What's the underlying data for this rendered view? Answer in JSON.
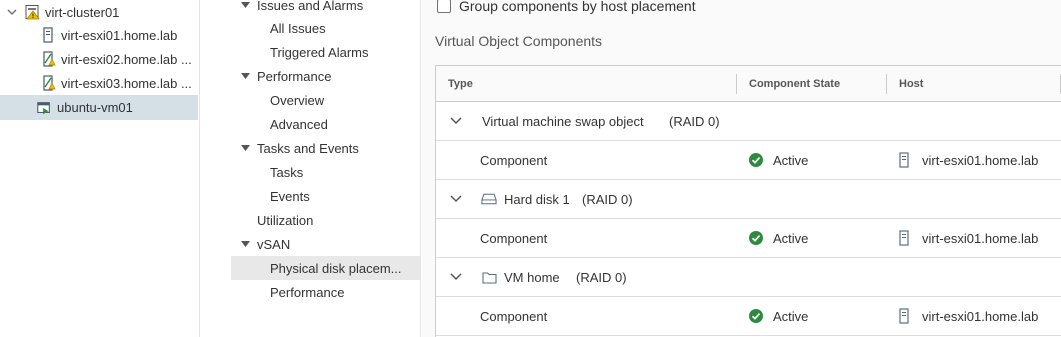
{
  "tree": {
    "cluster": "virt-cluster01",
    "hosts": [
      "virt-esxi01.home.lab",
      "virt-esxi02.home.lab ...",
      "virt-esxi03.home.lab ..."
    ],
    "vm": "ubuntu-vm01"
  },
  "nav": {
    "issues": "Issues and Alarms",
    "all_issues": "All Issues",
    "triggered_alarms": "Triggered Alarms",
    "performance": "Performance",
    "overview": "Overview",
    "advanced": "Advanced",
    "tasks_events": "Tasks and Events",
    "tasks": "Tasks",
    "events": "Events",
    "utilization": "Utilization",
    "vsan": "vSAN",
    "physical_disk": "Physical disk placem...",
    "vsan_performance": "Performance"
  },
  "main": {
    "group_checkbox_label": "Group components by host placement",
    "section_title": "Virtual Object Components",
    "columns": [
      "Type",
      "Component State",
      "Host"
    ],
    "objects": [
      {
        "name": "Virtual machine swap object",
        "raid": "(RAID 0)",
        "icon": "none"
      },
      {
        "name": "Hard disk 1",
        "raid": "(RAID 0)",
        "icon": "hard-disk-icon"
      },
      {
        "name": "VM home",
        "raid": "(RAID 0)",
        "icon": "folder-icon"
      }
    ],
    "components": [
      {
        "type": "Component",
        "state": "Active",
        "host": "virt-esxi01.home.lab"
      },
      {
        "type": "Component",
        "state": "Active",
        "host": "virt-esxi01.home.lab"
      },
      {
        "type": "Component",
        "state": "Active",
        "host": "virt-esxi01.home.lab"
      }
    ]
  },
  "colors": {
    "selected_row": "#d5dfe6",
    "active_green": "#2e8a3f",
    "warning_yellow": "#f2c200"
  }
}
